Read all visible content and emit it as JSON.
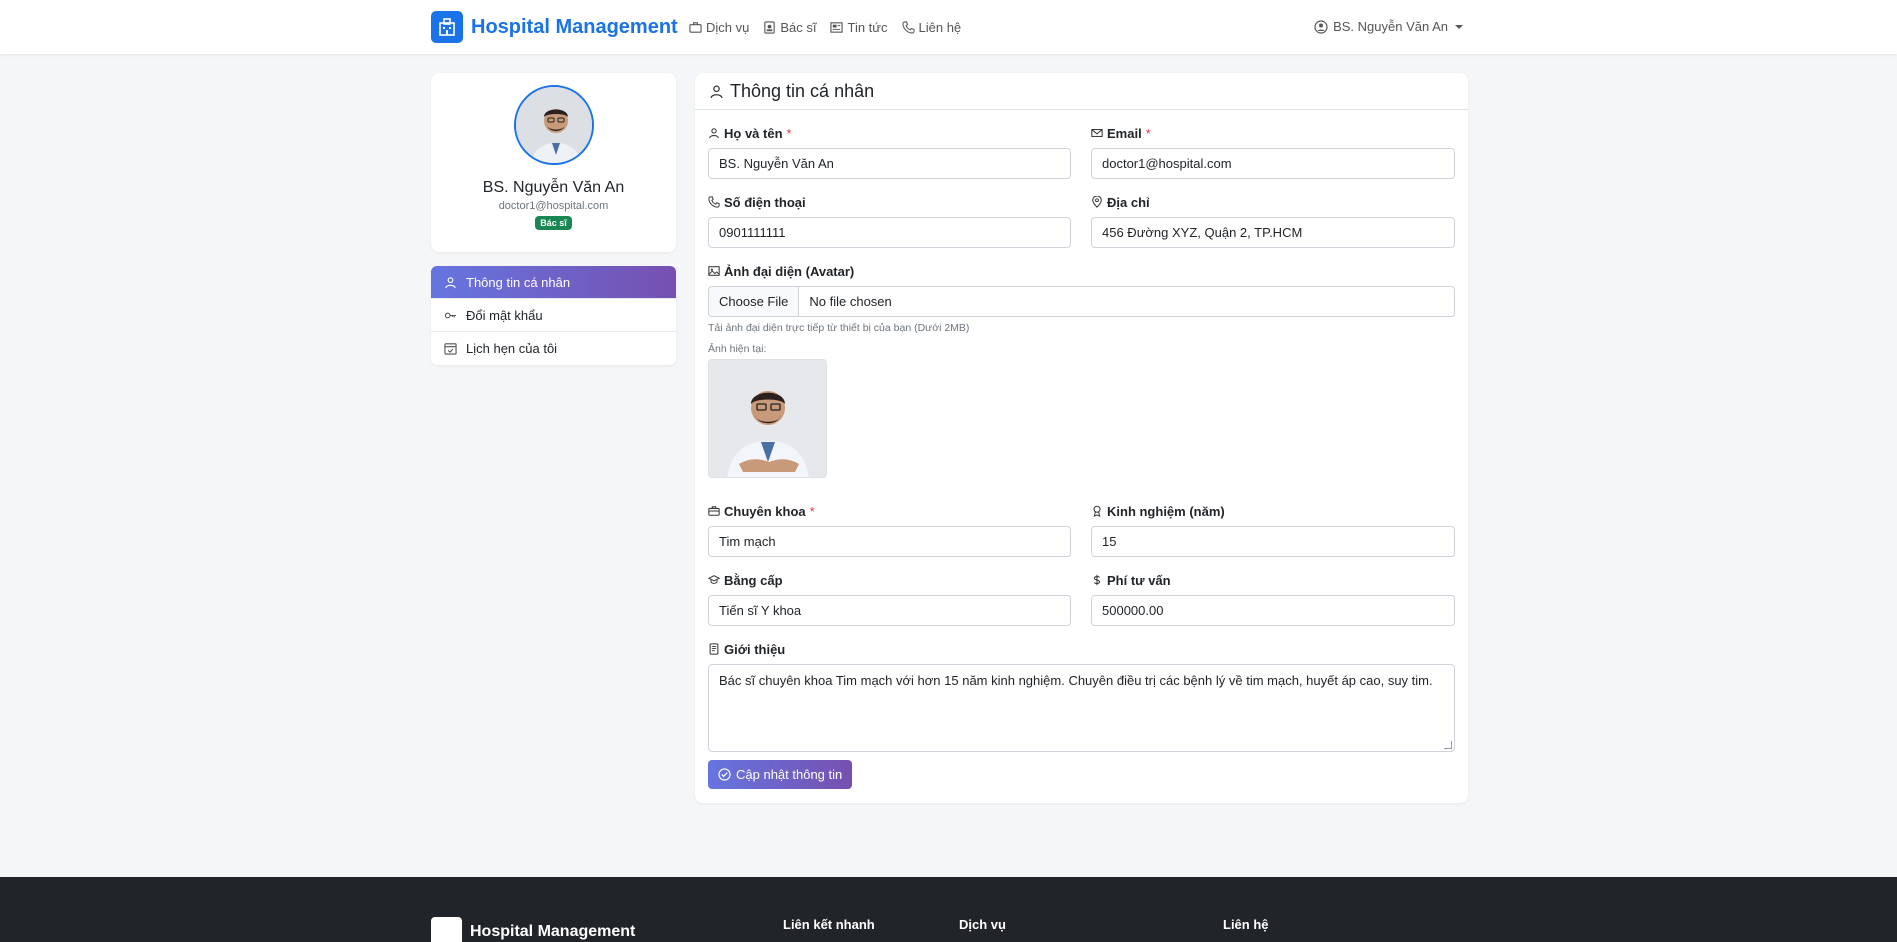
{
  "navbar": {
    "brand": "Hospital Management",
    "links": [
      "Dịch vụ",
      "Bác sĩ",
      "Tin tức",
      "Liên hệ"
    ],
    "user": "BS. Nguyễn Văn An"
  },
  "profile": {
    "name": "BS. Nguyễn Văn An",
    "email": "doctor1@hospital.com",
    "role": "Bác sĩ"
  },
  "sidebar": {
    "items": [
      {
        "label": "Thông tin cá nhân",
        "active": true
      },
      {
        "label": "Đổi mật khẩu",
        "active": false
      },
      {
        "label": "Lịch hẹn của tôi",
        "active": false
      }
    ]
  },
  "form": {
    "title": "Thông tin cá nhân",
    "required_mark": "*",
    "fullname": {
      "label": "Họ và tên",
      "value": "BS. Nguyễn Văn An"
    },
    "email": {
      "label": "Email",
      "value": "doctor1@hospital.com"
    },
    "phone": {
      "label": "Số điện thoại",
      "value": "0901111111"
    },
    "address": {
      "label": "Địa chỉ",
      "value": "456 Đường XYZ, Quận 2, TP.HCM"
    },
    "avatar": {
      "label": "Ảnh đại diện (Avatar)",
      "button": "Choose File",
      "file_status": "No file chosen",
      "help": "Tải ảnh đại diện trực tiếp từ thiết bị của bạn (Dưới 2MB)",
      "current_label": "Ảnh hiện tại:"
    },
    "specialty": {
      "label": "Chuyên khoa",
      "value": "Tim mạch"
    },
    "experience": {
      "label": "Kinh nghiệm (năm)",
      "value": "15"
    },
    "degree": {
      "label": "Bằng cấp",
      "value": "Tiến sĩ Y khoa"
    },
    "fee": {
      "label": "Phí tư vấn",
      "value": "500000.00"
    },
    "intro": {
      "label": "Giới thiệu",
      "value": "Bác sĩ chuyên khoa Tim mạch với hơn 15 năm kinh nghiệm. Chuyên điều trị các bệnh lý về tim mạch, huyết áp cao, suy tim."
    },
    "submit": "Cập nhật thông tin"
  },
  "footer": {
    "brand": "Hospital Management",
    "columns": [
      "Liên kết nhanh",
      "Dịch vụ",
      "Liên hệ"
    ]
  },
  "colors": {
    "primary": "#1a73e8",
    "gradient_start": "#6675e0",
    "gradient_end": "#7650b0",
    "badge_green": "#198754",
    "footer_bg": "#212529"
  }
}
